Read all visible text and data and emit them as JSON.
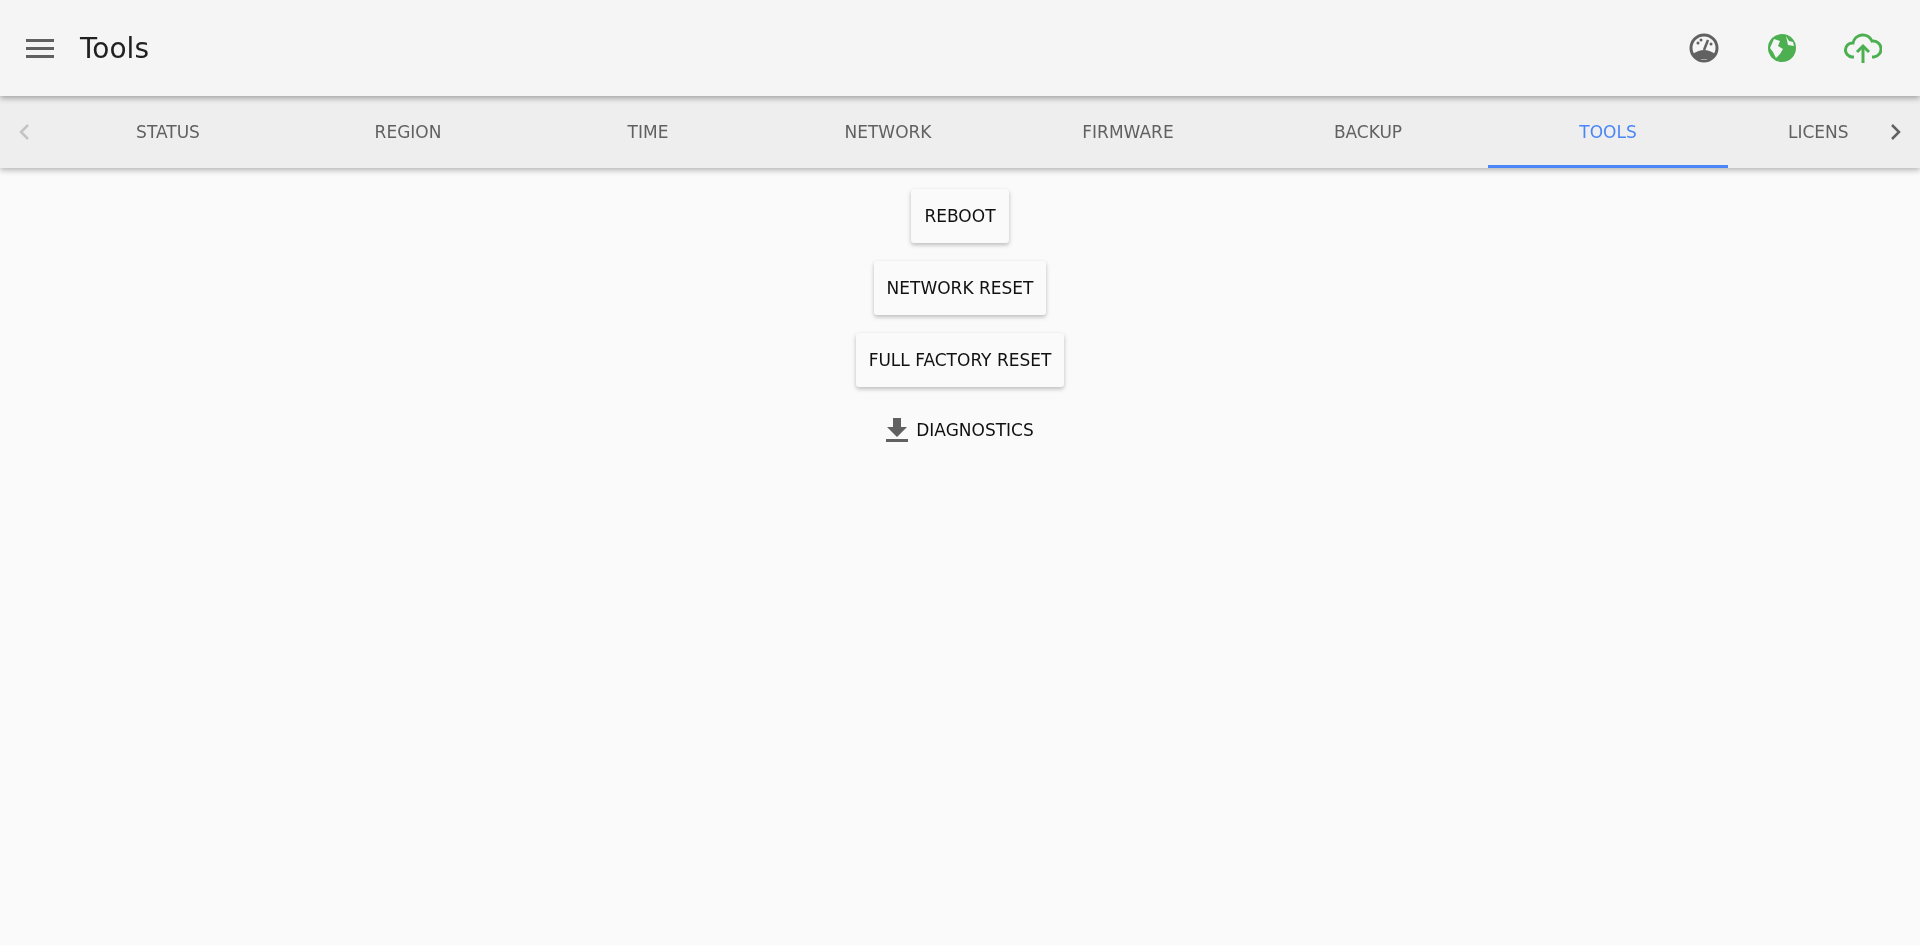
{
  "app_bar": {
    "title": "Tools"
  },
  "tabs": [
    {
      "label": "STATUS",
      "selected": false
    },
    {
      "label": "REGION",
      "selected": false
    },
    {
      "label": "TIME",
      "selected": false
    },
    {
      "label": "NETWORK",
      "selected": false
    },
    {
      "label": "FIRMWARE",
      "selected": false
    },
    {
      "label": "BACKUP",
      "selected": false
    },
    {
      "label": "TOOLS",
      "selected": true
    },
    {
      "label": "LICENS",
      "selected": false
    }
  ],
  "actions": [
    {
      "label": "REBOOT",
      "kind": "raised"
    },
    {
      "label": "NETWORK RESET",
      "kind": "raised"
    },
    {
      "label": "FULL FACTORY RESET",
      "kind": "raised"
    },
    {
      "label": "DIAGNOSTICS",
      "kind": "download"
    }
  ]
}
